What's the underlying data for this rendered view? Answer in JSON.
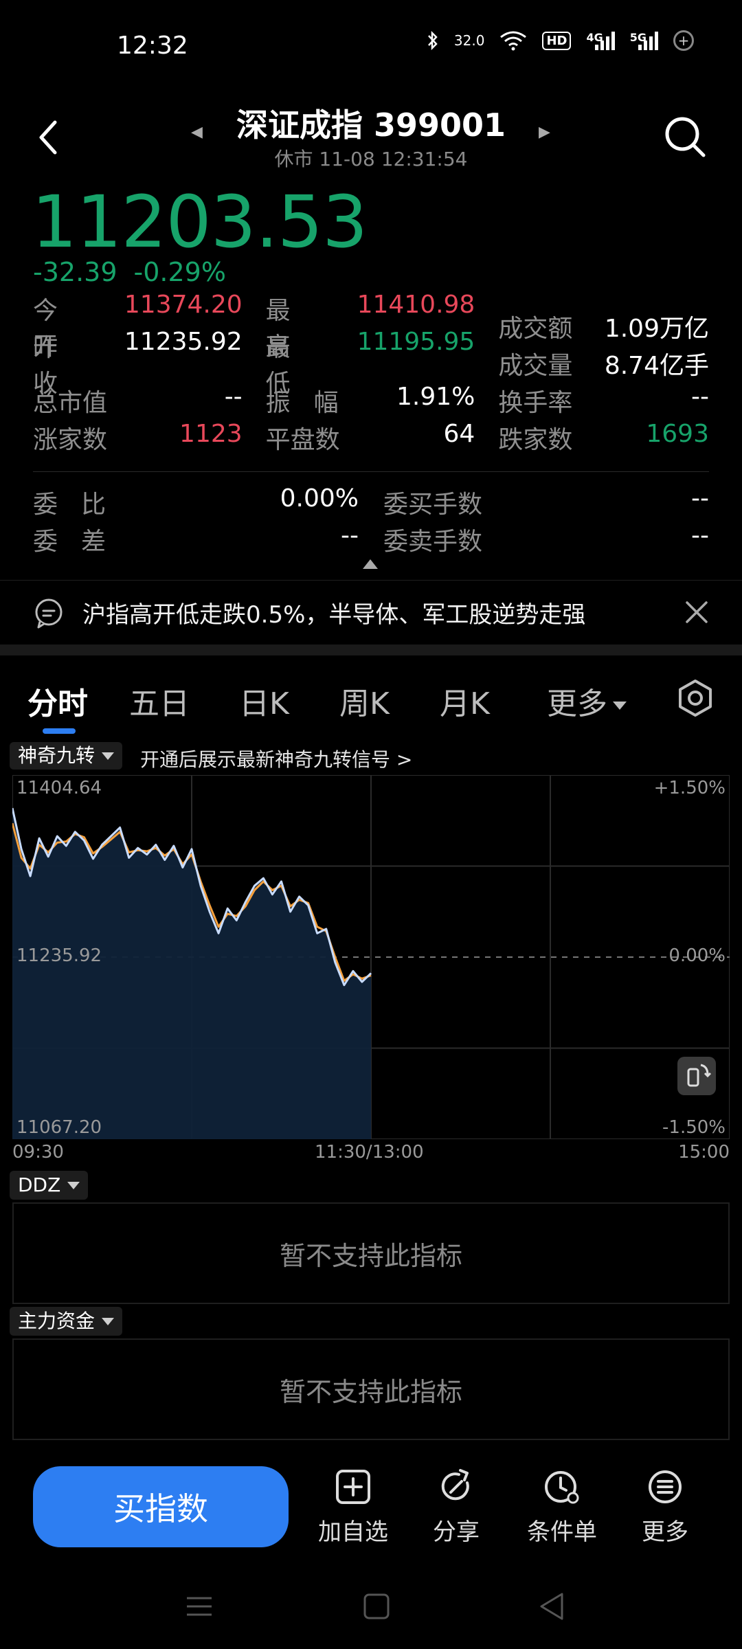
{
  "status_bar": {
    "time": "12:32",
    "speed": "32.0",
    "hd_badge": "HD",
    "network_a": "4G",
    "network_b": "5G",
    "icons": [
      "bluetooth-icon",
      "wifi-icon",
      "signal-icon",
      "add-circle-icon"
    ]
  },
  "header": {
    "title": "深证成指 399001",
    "subtitle": "休市 11-08 12:31:54"
  },
  "quote": {
    "price": "11203.53",
    "change": "-32.39",
    "change_pct": "-0.29%"
  },
  "stats": {
    "open_label": "今开",
    "open_value": "11374.20",
    "high_label": "最高",
    "high_value": "11410.98",
    "turnover_label": "成交额",
    "turnover_value": "1.09万亿",
    "prev_close_label": "昨收",
    "prev_close_value": "11235.92",
    "low_label": "最低",
    "low_value": "11195.95",
    "volume_label": "成交量",
    "volume_value": "8.74亿手",
    "market_cap_label": "总市值",
    "market_cap_value": "--",
    "amplitude_label": "振幅",
    "amplitude_value": "1.91%",
    "turnover_rate_label": "换手率",
    "turnover_rate_value": "--",
    "up_count_label": "涨家数",
    "up_count_value": "1123",
    "flat_count_label": "平盘数",
    "flat_count_value": "64",
    "down_count_label": "跌家数",
    "down_count_value": "1693"
  },
  "order_stats": {
    "bid_ratio_label": "委比",
    "bid_ratio_value": "0.00%",
    "buy_lots_label": "委买手数",
    "buy_lots_value": "--",
    "bid_diff_label": "委差",
    "bid_diff_value": "--",
    "sell_lots_label": "委卖手数",
    "sell_lots_value": "--"
  },
  "news": {
    "text": "沪指高开低走跌0.5%，半导体、军工股逆势走强"
  },
  "tabs": [
    "分时",
    "五日",
    "日K",
    "周K",
    "月K",
    "更多"
  ],
  "indicator": {
    "name": "神奇九转",
    "signal_text": "开通后展示最新神奇九转信号 >"
  },
  "chart_labels": {
    "high": "11404.64",
    "mid": "11235.92",
    "low": "11067.20",
    "pct_high": "+1.50%",
    "pct_mid": "0.00%",
    "pct_low": "-1.50%",
    "x_start": "09:30",
    "x_mid": "11:30/13:00",
    "x_end": "15:00"
  },
  "chart_data": {
    "type": "line",
    "ylim": [
      11067.2,
      11404.64
    ],
    "reference": 11235.92,
    "session_minutes": 240,
    "series": [
      {
        "color": "#c8dcff",
        "x": [
          0,
          3,
          6,
          9,
          12,
          15,
          18,
          21,
          24,
          27,
          30,
          33,
          36,
          39,
          42,
          45,
          48,
          51,
          54,
          57,
          60,
          63,
          66,
          69,
          72,
          75,
          78,
          81,
          84,
          87,
          90,
          93,
          96,
          99,
          102,
          105,
          108,
          111,
          114,
          117,
          120
        ],
        "values": [
          11374,
          11336,
          11311,
          11346,
          11329,
          11348,
          11339,
          11352,
          11344,
          11327,
          11340,
          11348,
          11356,
          11328,
          11337,
          11331,
          11340,
          11326,
          11339,
          11319,
          11336,
          11302,
          11278,
          11258,
          11281,
          11270,
          11287,
          11302,
          11309,
          11294,
          11306,
          11278,
          11292,
          11284,
          11258,
          11262,
          11231,
          11210,
          11223,
          11213,
          11221
        ]
      },
      {
        "color": "#f5a03c",
        "x": [
          0,
          3,
          6,
          9,
          12,
          15,
          18,
          21,
          24,
          27,
          30,
          33,
          36,
          39,
          42,
          45,
          48,
          51,
          54,
          57,
          60,
          63,
          66,
          69,
          72,
          75,
          78,
          81,
          84,
          87,
          90,
          93,
          96,
          99,
          102,
          105,
          108,
          111,
          114,
          117,
          120
        ],
        "values": [
          11360,
          11328,
          11318,
          11340,
          11333,
          11342,
          11343,
          11350,
          11347,
          11332,
          11338,
          11345,
          11352,
          11333,
          11335,
          11334,
          11337,
          11330,
          11336,
          11322,
          11331,
          11306,
          11284,
          11264,
          11276,
          11274,
          11283,
          11298,
          11306,
          11298,
          11302,
          11283,
          11289,
          11286,
          11264,
          11260,
          11236,
          11214,
          11220,
          11216,
          11219
        ]
      }
    ]
  },
  "sub_panels": {
    "ddz_label": "DDZ",
    "ddz_message": "暂不支持此指标",
    "fund_label": "主力资金",
    "fund_message": "暂不支持此指标"
  },
  "actions": {
    "buy": "买指数",
    "add_watch": "加自选",
    "share": "分享",
    "condition_order": "条件单",
    "more": "更多"
  }
}
